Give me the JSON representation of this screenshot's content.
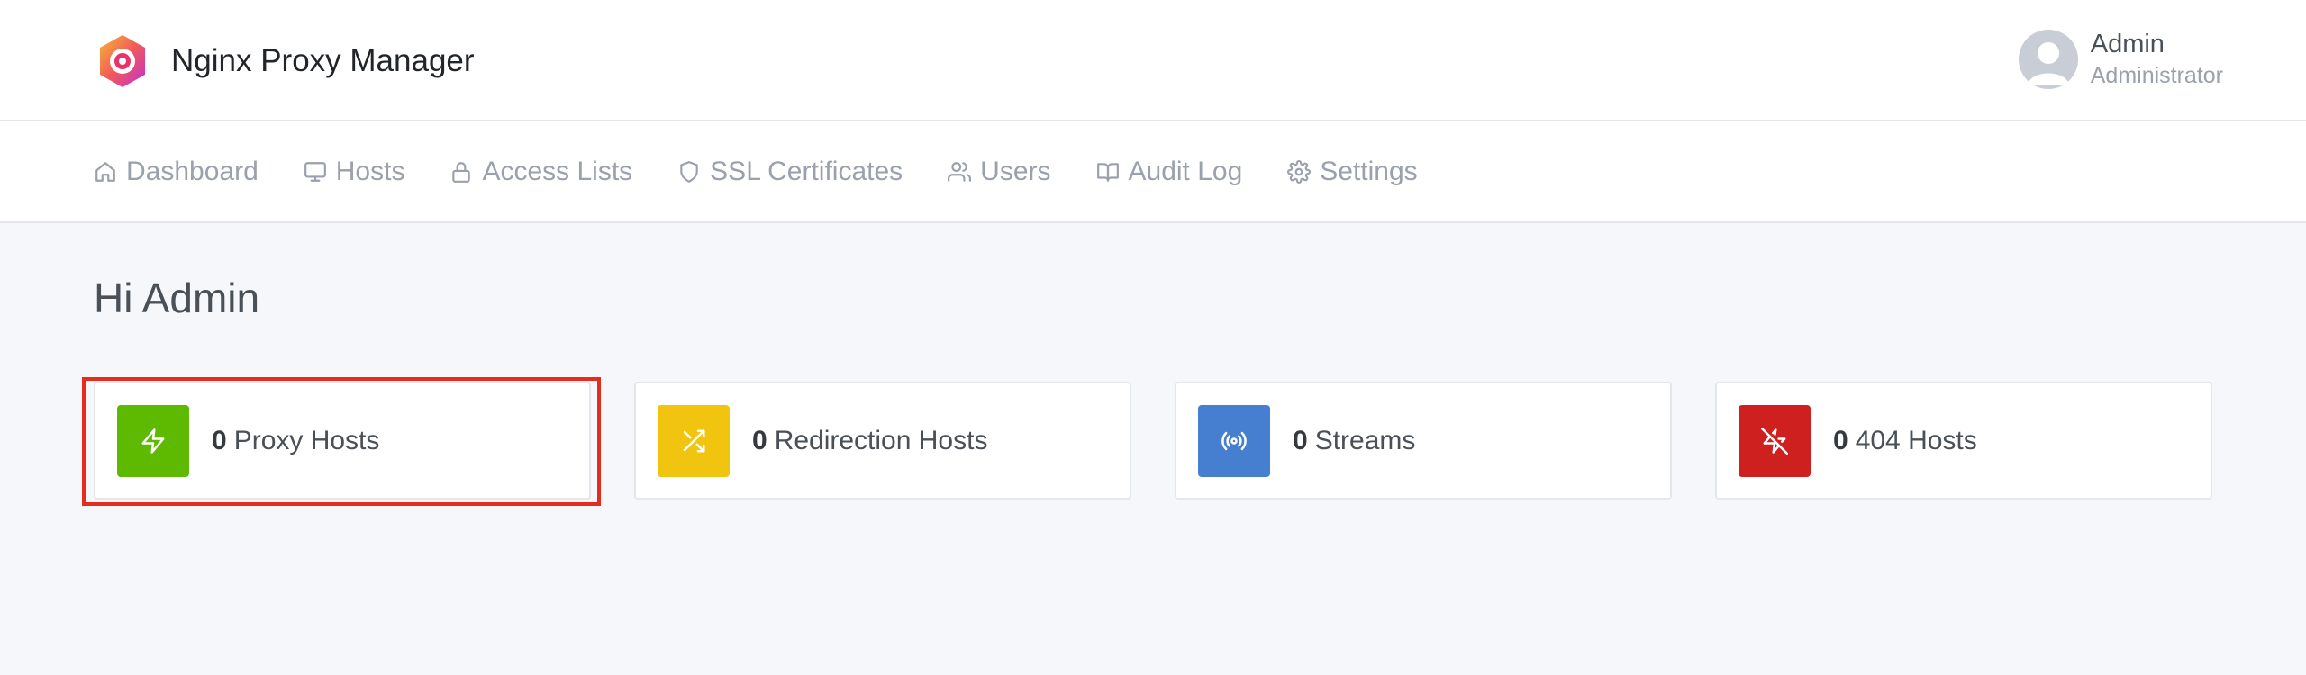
{
  "app": {
    "name": "Nginx Proxy Manager"
  },
  "user": {
    "name": "Admin",
    "role": "Administrator"
  },
  "nav": {
    "items": [
      {
        "label": "Dashboard",
        "icon": "home-icon"
      },
      {
        "label": "Hosts",
        "icon": "monitor-icon"
      },
      {
        "label": "Access Lists",
        "icon": "lock-icon"
      },
      {
        "label": "SSL Certificates",
        "icon": "shield-icon"
      },
      {
        "label": "Users",
        "icon": "users-icon"
      },
      {
        "label": "Audit Log",
        "icon": "book-icon"
      },
      {
        "label": "Settings",
        "icon": "gear-icon"
      }
    ]
  },
  "page": {
    "greeting": "Hi Admin"
  },
  "cards": [
    {
      "count": "0",
      "label": "Proxy Hosts",
      "icon": "zap-icon",
      "color": "#5eba00"
    },
    {
      "count": "0",
      "label": "Redirection Hosts",
      "icon": "shuffle-icon",
      "color": "#f1c40f"
    },
    {
      "count": "0",
      "label": "Streams",
      "icon": "radio-icon",
      "color": "#467fcf"
    },
    {
      "count": "0",
      "label": "404 Hosts",
      "icon": "zap-off-icon",
      "color": "#cd201f"
    }
  ],
  "highlight": {
    "color": "#e52d1f"
  }
}
